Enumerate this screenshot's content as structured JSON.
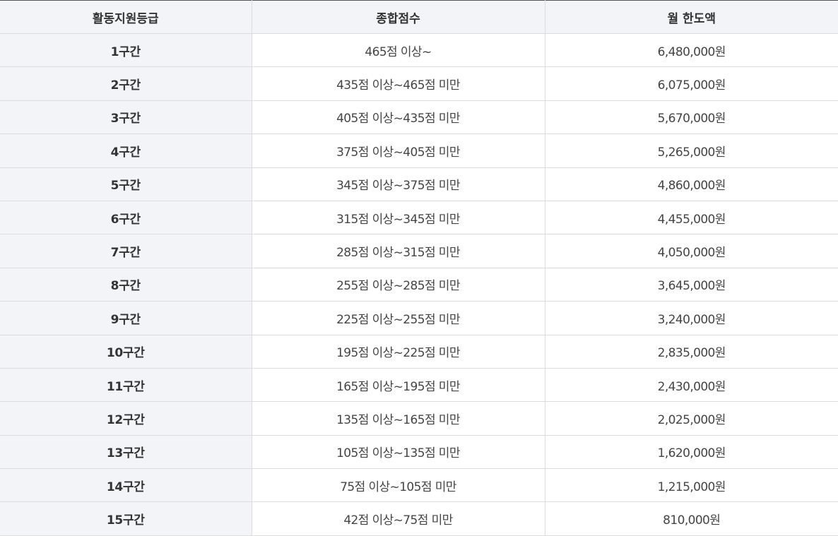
{
  "table": {
    "headers": [
      "활동지원등급",
      "종합점수",
      "월 한도액"
    ],
    "rows": [
      {
        "grade": "1구간",
        "score": "465점 이상~",
        "limit": "6,480,000원"
      },
      {
        "grade": "2구간",
        "score": "435점 이상~465점 미만",
        "limit": "6,075,000원"
      },
      {
        "grade": "3구간",
        "score": "405점 이상~435점 미만",
        "limit": "5,670,000원"
      },
      {
        "grade": "4구간",
        "score": "375점 이상~405점 미만",
        "limit": "5,265,000원"
      },
      {
        "grade": "5구간",
        "score": "345점 이상~375점 미만",
        "limit": "4,860,000원"
      },
      {
        "grade": "6구간",
        "score": "315점 이상~345점 미만",
        "limit": "4,455,000원"
      },
      {
        "grade": "7구간",
        "score": "285점 이상~315점 미만",
        "limit": "4,050,000원"
      },
      {
        "grade": "8구간",
        "score": "255점 이상~285점 미만",
        "limit": "3,645,000원"
      },
      {
        "grade": "9구간",
        "score": "225점 이상~255점 미만",
        "limit": "3,240,000원"
      },
      {
        "grade": "10구간",
        "score": "195점 이상~225점 미만",
        "limit": "2,835,000원"
      },
      {
        "grade": "11구간",
        "score": "165점 이상~195점 미만",
        "limit": "2,430,000원"
      },
      {
        "grade": "12구간",
        "score": "135점 이상~165점 미만",
        "limit": "2,025,000원"
      },
      {
        "grade": "13구간",
        "score": "105점 이상~135점 미만",
        "limit": "1,620,000원"
      },
      {
        "grade": "14구간",
        "score": "75점 이상~105점 미만",
        "limit": "1,215,000원"
      },
      {
        "grade": "15구간",
        "score": "42점 이상~75점 미만",
        "limit": "810,000원"
      }
    ]
  }
}
